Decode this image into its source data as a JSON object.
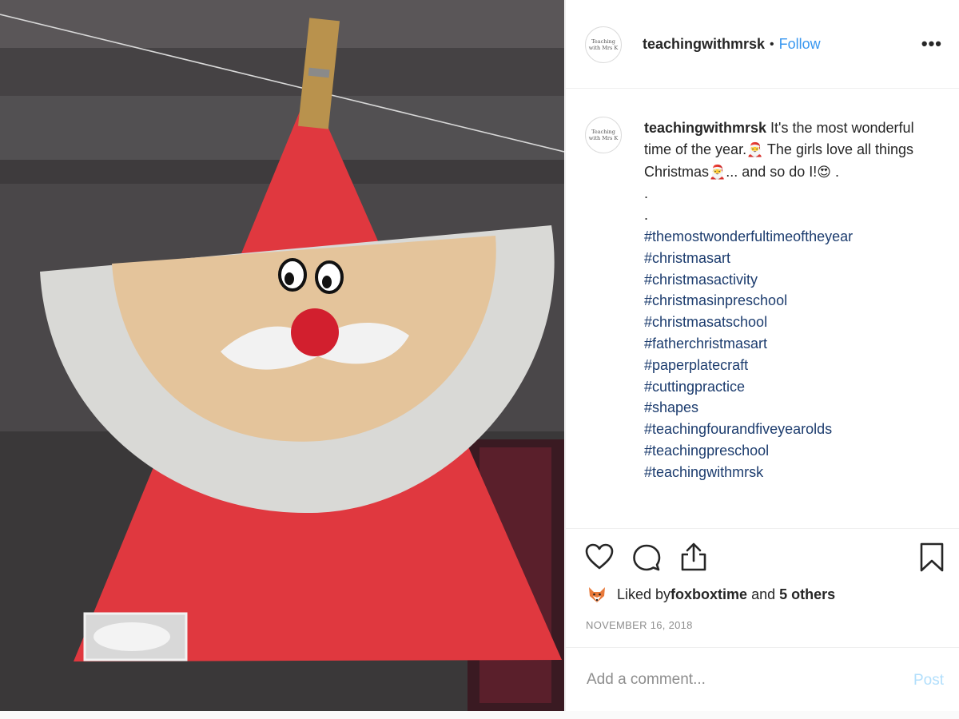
{
  "photo": {
    "description_icon": "santa-paper-plate-craft"
  },
  "header": {
    "avatar_text": "Teaching with Mrs K",
    "username": "teachingwithmrsk",
    "dot": "•",
    "follow": "Follow",
    "more": "•••"
  },
  "caption": {
    "username": "teachingwithmrsk",
    "text_1": " It's the most wonderful time of the year.",
    "text_2": " The girls love all things Christmas",
    "text_3": "... and so do I!",
    "text_4": " .",
    "dot_a": ".",
    "dot_b": ".",
    "emoji_santa": "🎅",
    "emoji_heart_eyes": "😍",
    "hashtags": [
      "#themostwonderfultimeoftheyear",
      "#christmasart",
      "#christmasactivity",
      "#christmasinpreschool",
      "#christmasatschool",
      "#fatherchristmasart",
      "#paperplatecraft",
      "#cuttingpractice",
      "#shapes",
      "#teachingfourandfiveyearolds",
      "#teachingpreschool",
      "#teachingwithmrsk"
    ]
  },
  "actions": {
    "icons": [
      "heart-icon",
      "comment-icon",
      "share-icon",
      "bookmark-icon"
    ],
    "liked_by_prefix": "Liked by ",
    "liked_by_user": "foxboxtime",
    "liked_by_and": " and ",
    "liked_by_others": "5 others",
    "date": "NOVEMBER 16, 2018"
  },
  "comment": {
    "placeholder": "Add a comment...",
    "post": "Post"
  },
  "colors": {
    "accent": "#3897f0",
    "post_disabled": "#b2dffc",
    "hashtag": "#1c3c6e",
    "muted": "#8e8e8e"
  }
}
